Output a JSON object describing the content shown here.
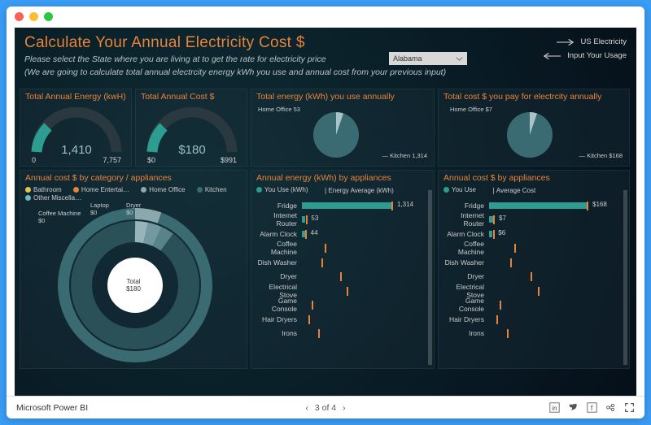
{
  "header": {
    "title": "Calculate Your Annual Electricity Cost $",
    "subtitle1": "Please select the State where you are living at to get the rate for electricity price",
    "subtitle2": "(We are going to calculate total annual electrcity energy kWh you use and annual cost from your previous input)"
  },
  "state_selector": {
    "value": "Alabama"
  },
  "nav": {
    "us": "US Electricity",
    "input": "Input Your Usage"
  },
  "gauges": {
    "energy": {
      "title": "Total Annual Energy (kwH)",
      "value": "1,410",
      "min": "0",
      "max": "7,757"
    },
    "cost": {
      "title": "Total Annual Cost $",
      "value": "$180",
      "min": "$0",
      "max": "$991"
    }
  },
  "pies": {
    "energy": {
      "title": "Total energy (kWh) you use annually",
      "labels": {
        "ho": "Home Office 53",
        "ki": "Kitchen 1,314"
      }
    },
    "cost": {
      "title": "Total cost $ you pay for electrcity annually",
      "labels": {
        "ho": "Home Office $7",
        "ki": "Kitchen $168"
      }
    }
  },
  "donut": {
    "title": "Annual cost $ by category / appliances",
    "center_label": "Total",
    "center_value": "$180",
    "legend": [
      "Bathroom",
      "Home Entertai…",
      "Home Office",
      "Kitchen",
      "Other Miscella…"
    ],
    "labels": {
      "cm": "Coffee Machine\n$0",
      "lp": "Laptop\n$0",
      "dr": "Dryer\n$0"
    }
  },
  "bars_energy": {
    "title": "Annual energy (kWh) by appliances",
    "legend": {
      "a": "You Use (kWh)",
      "b": "Energy Average (kWh)"
    }
  },
  "bars_cost": {
    "title": "Annual cost $ by appliances",
    "legend": {
      "a": "You Use",
      "b": "Average Cost"
    }
  },
  "appliances": [
    "Fridge",
    "Internet Router",
    "Alarm Clock",
    "Coffee Machine",
    "Dish Washer",
    "Dryer",
    "Electrical Stove",
    "Game Console",
    "Hair Dryers",
    "Irons"
  ],
  "bar_values_energy": {
    "Fridge": "1,314",
    "Internet Router": "53",
    "Alarm Clock": "44"
  },
  "bar_values_cost": {
    "Fridge": "$168",
    "Internet Router": "$7",
    "Alarm Clock": "$6"
  },
  "footer": {
    "brand": "Microsoft Power BI",
    "page": "3 of 4"
  },
  "colors": {
    "accent": "#e8843a",
    "teal": "#2d9d91",
    "pie": "#3a6a72"
  },
  "chart_data": [
    {
      "type": "gauge",
      "title": "Total Annual Energy (kwH)",
      "value": 1410,
      "min": 0,
      "max": 7757,
      "unit": "kWh"
    },
    {
      "type": "gauge",
      "title": "Total Annual Cost $",
      "value": 180,
      "min": 0,
      "max": 991,
      "unit": "$"
    },
    {
      "type": "pie",
      "title": "Total energy (kWh) you use annually",
      "series": [
        {
          "name": "Kitchen",
          "value": 1314
        },
        {
          "name": "Home Office",
          "value": 53
        }
      ]
    },
    {
      "type": "pie",
      "title": "Total cost $ you pay for electrcity annually",
      "series": [
        {
          "name": "Kitchen",
          "value": 168
        },
        {
          "name": "Home Office",
          "value": 7
        }
      ]
    },
    {
      "type": "donut",
      "title": "Annual cost $ by category / appliances",
      "total": 180,
      "outer_ring_series": [
        {
          "name": "Kitchen",
          "value": 168
        },
        {
          "name": "Home Office",
          "value": 7
        },
        {
          "name": "Home Entertainment",
          "value": 3
        },
        {
          "name": "Bathroom",
          "value": 1
        },
        {
          "name": "Other Miscellaneous",
          "value": 1
        }
      ],
      "inner_ring_labels": [
        "Coffee Machine $0",
        "Laptop $0",
        "Dryer $0"
      ]
    },
    {
      "type": "bar",
      "title": "Annual energy (kWh) by appliances",
      "categories": [
        "Fridge",
        "Internet Router",
        "Alarm Clock",
        "Coffee Machine",
        "Dish Washer",
        "Dryer",
        "Electrical Stove",
        "Game Console",
        "Hair Dryers",
        "Irons"
      ],
      "series": [
        {
          "name": "You Use (kWh)",
          "values": [
            1314,
            53,
            44,
            0,
            0,
            0,
            0,
            0,
            0,
            0
          ]
        },
        {
          "name": "Energy Average (kWh)",
          "values": [
            1400,
            60,
            50,
            350,
            300,
            600,
            700,
            150,
            100,
            250
          ]
        }
      ],
      "xlabel": "",
      "ylabel": "kWh"
    },
    {
      "type": "bar",
      "title": "Annual cost $ by appliances",
      "categories": [
        "Fridge",
        "Internet Router",
        "Alarm Clock",
        "Coffee Machine",
        "Dish Washer",
        "Dryer",
        "Electrical Stove",
        "Game Console",
        "Hair Dryers",
        "Irons"
      ],
      "series": [
        {
          "name": "You Use",
          "values": [
            168,
            7,
            6,
            0,
            0,
            0,
            0,
            0,
            0,
            0
          ]
        },
        {
          "name": "Average Cost",
          "values": [
            175,
            8,
            7,
            45,
            38,
            75,
            88,
            19,
            13,
            32
          ]
        }
      ],
      "xlabel": "",
      "ylabel": "$"
    }
  ]
}
